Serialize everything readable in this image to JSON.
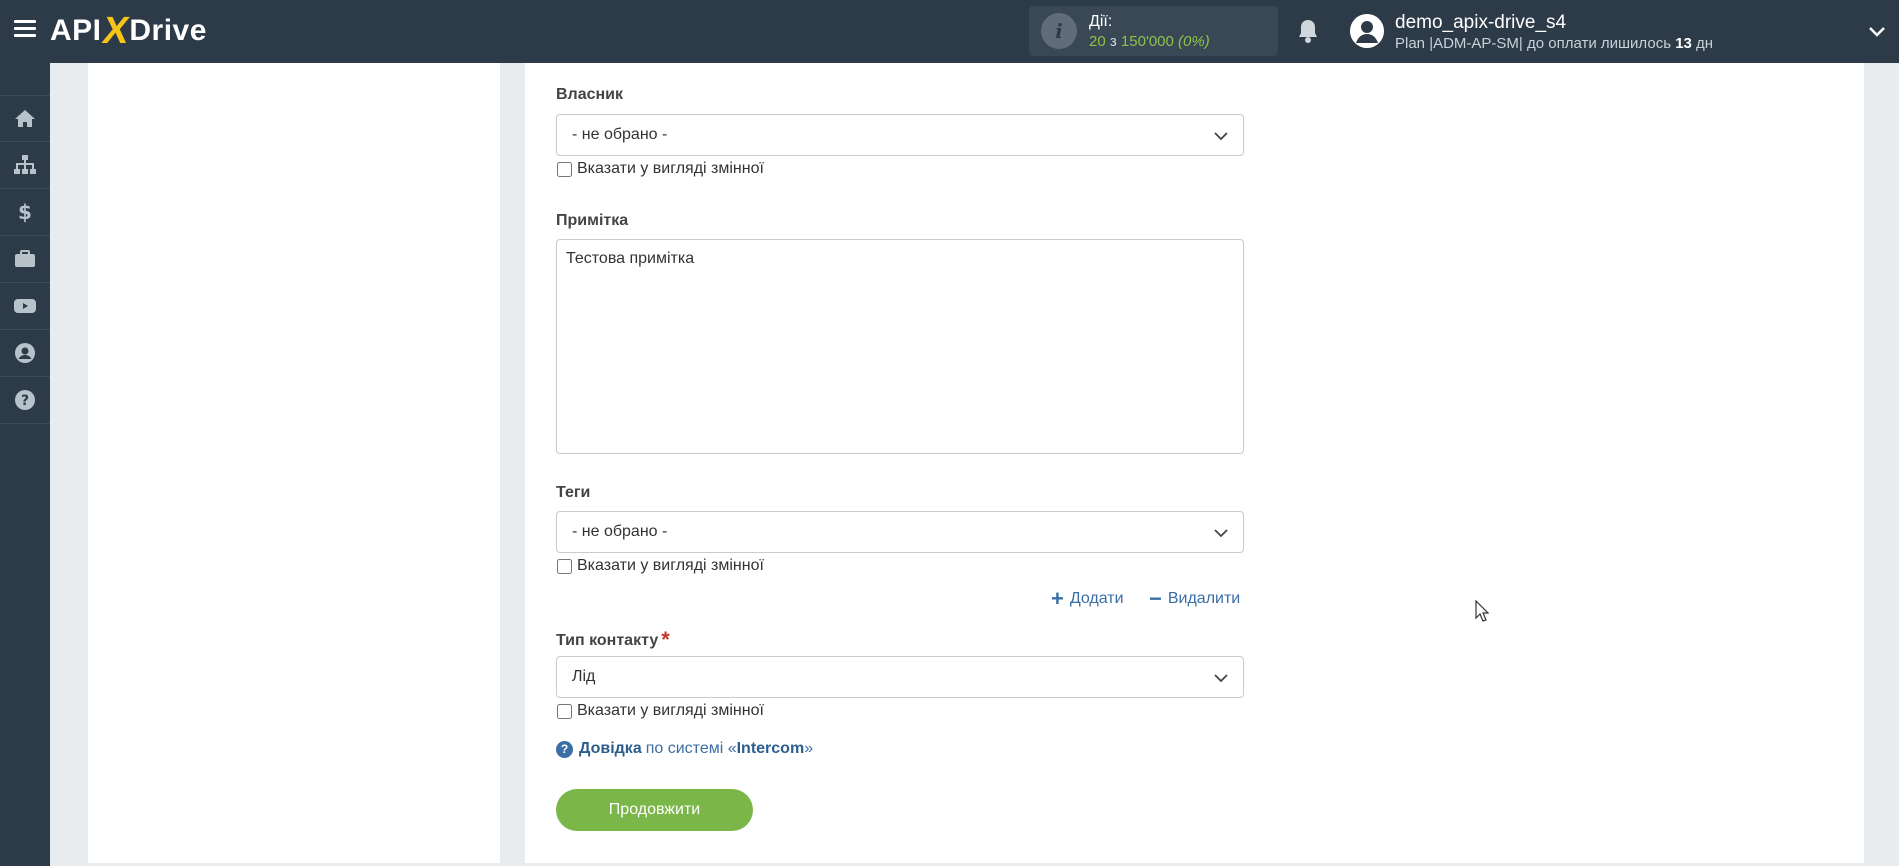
{
  "header": {
    "logo_left": "API",
    "logo_x": "X",
    "logo_right": "Drive",
    "actions_label": "Дії:",
    "actions_used": "20",
    "actions_sep": "з",
    "actions_total": "150'000",
    "actions_percent": "(0%)",
    "user_name": "demo_apix-drive_s4",
    "plan_prefix": "Plan |ADM-AP-SM| до оплати лишилось",
    "plan_days": "13",
    "plan_suffix": "дн"
  },
  "sidebar": {
    "items": [
      {
        "icon": "home-icon"
      },
      {
        "icon": "sitemap-icon"
      },
      {
        "icon": "dollar-icon"
      },
      {
        "icon": "briefcase-icon"
      },
      {
        "icon": "youtube-icon"
      },
      {
        "icon": "user-circle-icon"
      },
      {
        "icon": "question-circle-icon"
      }
    ]
  },
  "form": {
    "owner": {
      "label": "Власник",
      "value": "- не обрано -",
      "checkbox_label": "Вказати у вигляді змінної"
    },
    "note": {
      "label": "Примітка",
      "value": "Тестова примітка"
    },
    "tags": {
      "label": "Теги",
      "value": "- не обрано -",
      "checkbox_label": "Вказати у вигляді змінної"
    },
    "add_label": "Додати",
    "remove_label": "Видалити",
    "contact_type": {
      "label": "Тип контакту",
      "required_mark": "*",
      "value": "Лід",
      "checkbox_label": "Вказати у вигляді змінної"
    },
    "help": {
      "link": "Довідка",
      "middle": "по системі «",
      "system": "Intercom",
      "end": "»"
    },
    "continue_label": "Продовжити"
  },
  "colors": {
    "header_bg": "#2d3b49",
    "accent_green": "#7ab648",
    "link_blue": "#3a6ea5",
    "logo_x": "#f5c518"
  }
}
